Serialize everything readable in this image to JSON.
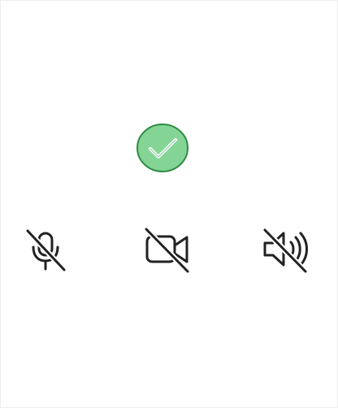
{
  "status": {
    "icon": "check-circle-icon",
    "fill_color": "#84d595",
    "stroke_color": "#2f8b45",
    "state": "success"
  },
  "controls": [
    {
      "id": "microphone",
      "icon": "microphone-muted-icon",
      "state": "off"
    },
    {
      "id": "camera",
      "icon": "video-camera-off-icon",
      "state": "off"
    },
    {
      "id": "speaker",
      "icon": "speaker-muted-icon",
      "state": "off"
    }
  ],
  "colors": {
    "background": "#ffffff",
    "icon_stroke": "#222222"
  }
}
